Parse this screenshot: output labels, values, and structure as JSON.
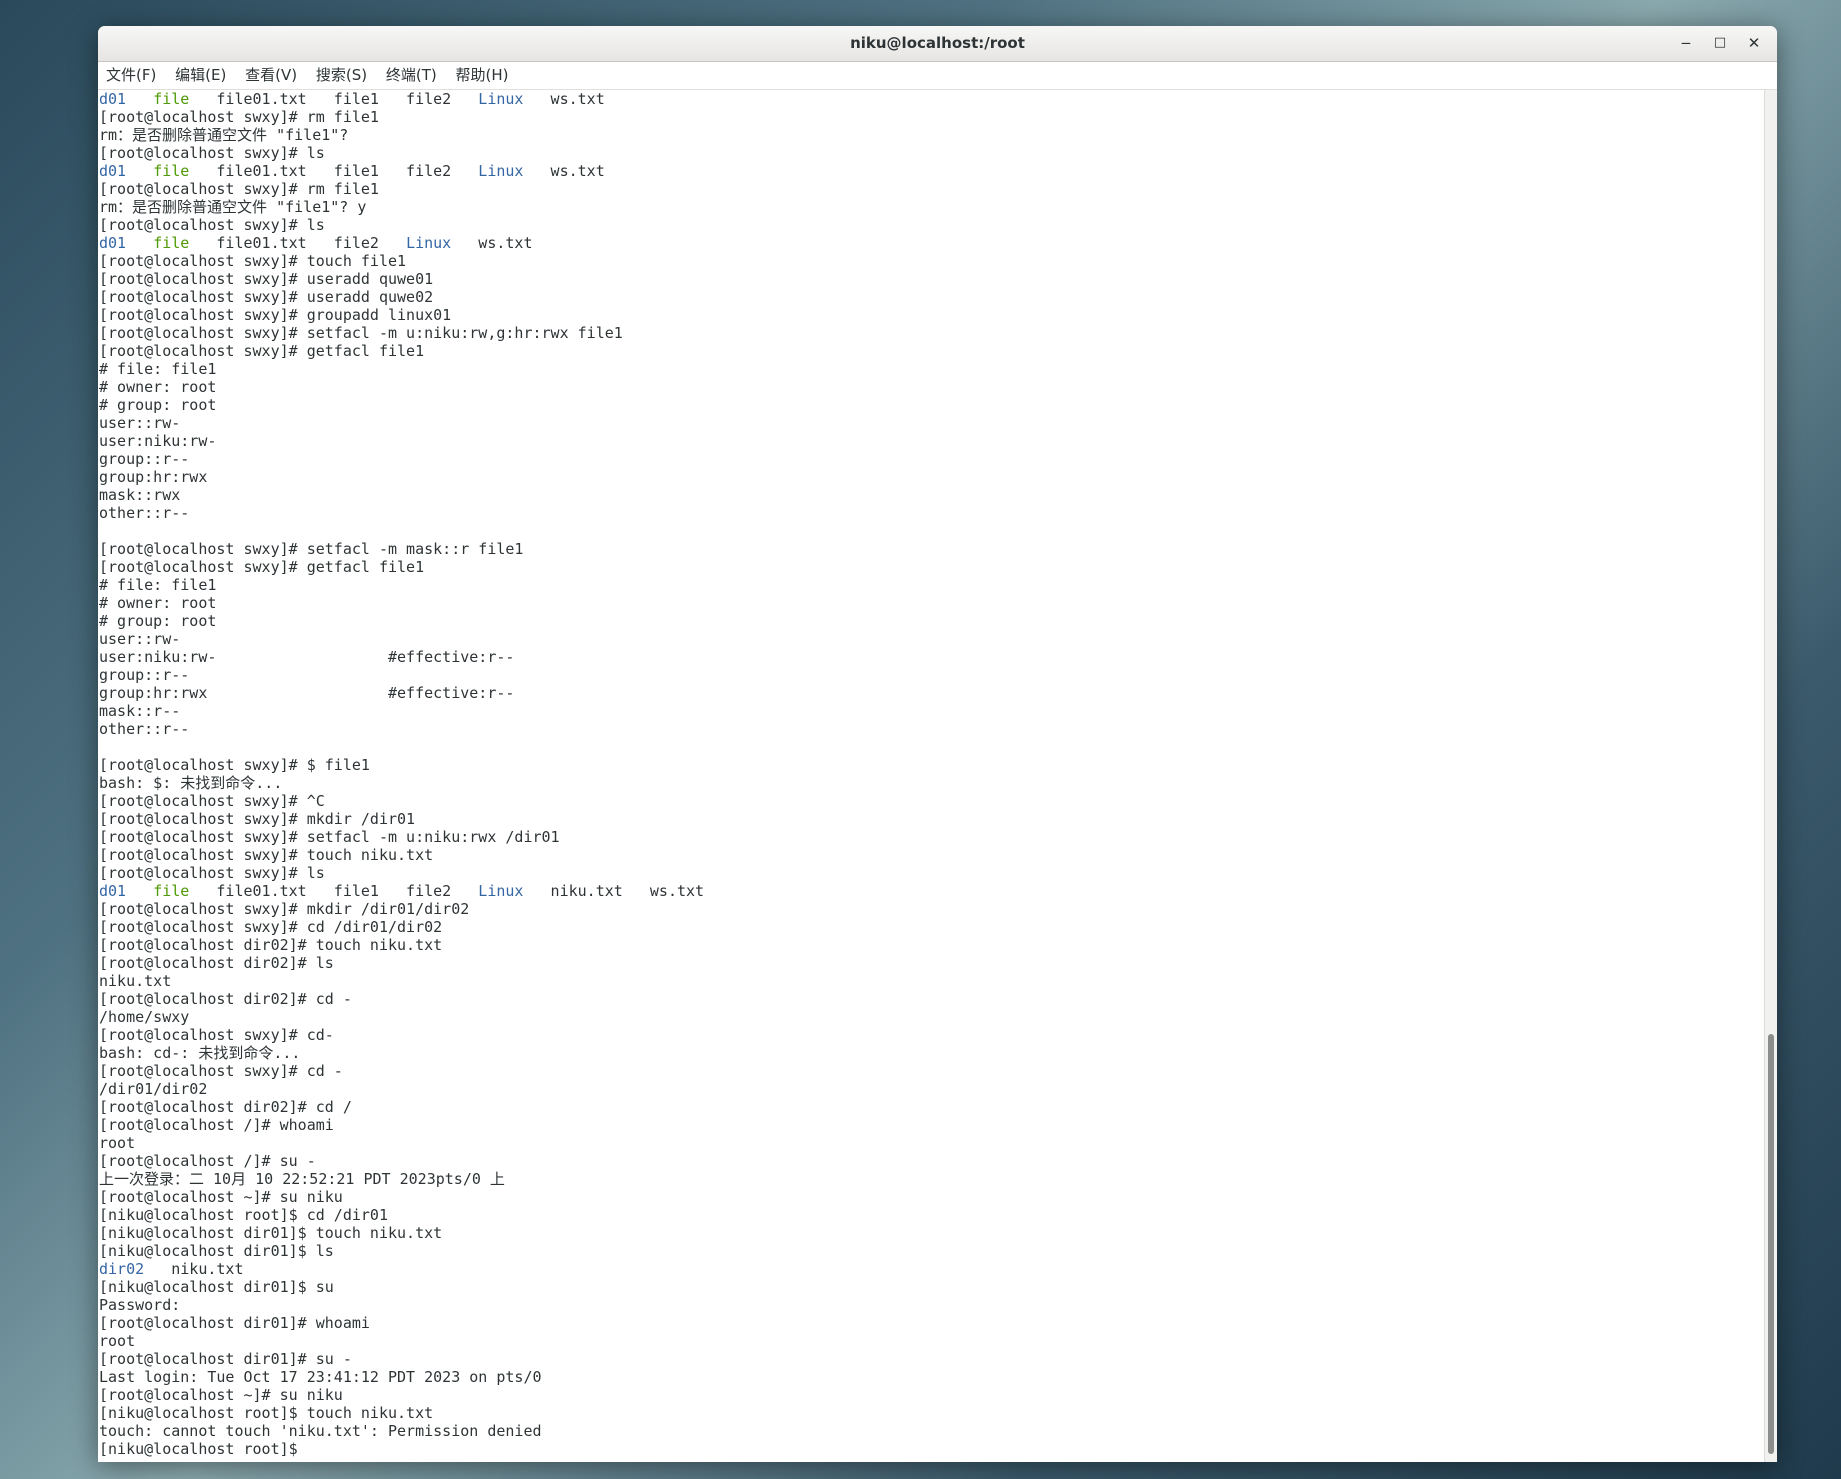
{
  "window": {
    "title": "niku@localhost:/root",
    "controls": {
      "minimize": "‒",
      "maximize": "□",
      "close": "✕"
    }
  },
  "menu": [
    "文件(F)",
    "编辑(E)",
    "查看(V)",
    "搜索(S)",
    "终端(T)",
    "帮助(H)"
  ],
  "colors": {
    "directory": "#3465a4",
    "executable": "#4e9a06",
    "text": "#2e3436"
  },
  "terminal": {
    "lines": [
      [
        {
          "t": "d01",
          "c": "dir"
        },
        {
          "t": "   "
        },
        {
          "t": "file",
          "c": "exe"
        },
        {
          "t": "   file01.txt   file1   file2   "
        },
        {
          "t": "Linux",
          "c": "dir"
        },
        {
          "t": "   ws.txt"
        }
      ],
      "[root@localhost swxy]# rm file1",
      "rm：是否删除普通空文件 \"file1\"?",
      "[root@localhost swxy]# ls",
      [
        {
          "t": "d01",
          "c": "dir"
        },
        {
          "t": "   "
        },
        {
          "t": "file",
          "c": "exe"
        },
        {
          "t": "   file01.txt   file1   file2   "
        },
        {
          "t": "Linux",
          "c": "dir"
        },
        {
          "t": "   ws.txt"
        }
      ],
      "[root@localhost swxy]# rm file1",
      "rm：是否删除普通空文件 \"file1\"? y",
      "[root@localhost swxy]# ls",
      [
        {
          "t": "d01",
          "c": "dir"
        },
        {
          "t": "   "
        },
        {
          "t": "file",
          "c": "exe"
        },
        {
          "t": "   file01.txt   file2   "
        },
        {
          "t": "Linux",
          "c": "dir"
        },
        {
          "t": "   ws.txt"
        }
      ],
      "[root@localhost swxy]# touch file1",
      "[root@localhost swxy]# useradd quwe01",
      "[root@localhost swxy]# useradd quwe02",
      "[root@localhost swxy]# groupadd linux01",
      "[root@localhost swxy]# setfacl -m u:niku:rw,g:hr:rwx file1",
      "[root@localhost swxy]# getfacl file1",
      "# file: file1",
      "# owner: root",
      "# group: root",
      "user::rw-",
      "user:niku:rw-",
      "group::r--",
      "group:hr:rwx",
      "mask::rwx",
      "other::r--",
      "",
      "[root@localhost swxy]# setfacl -m mask::r file1",
      "[root@localhost swxy]# getfacl file1",
      "# file: file1",
      "# owner: root",
      "# group: root",
      "user::rw-",
      "user:niku:rw-                   #effective:r--",
      "group::r--",
      "group:hr:rwx                    #effective:r--",
      "mask::r--",
      "other::r--",
      "",
      "[root@localhost swxy]# $ file1",
      "bash: $: 未找到命令...",
      "[root@localhost swxy]# ^C",
      "[root@localhost swxy]# mkdir /dir01",
      "[root@localhost swxy]# setfacl -m u:niku:rwx /dir01",
      "[root@localhost swxy]# touch niku.txt",
      "[root@localhost swxy]# ls",
      [
        {
          "t": "d01",
          "c": "dir"
        },
        {
          "t": "   "
        },
        {
          "t": "file",
          "c": "exe"
        },
        {
          "t": "   file01.txt   file1   file2   "
        },
        {
          "t": "Linux",
          "c": "dir"
        },
        {
          "t": "   niku.txt   ws.txt"
        }
      ],
      "[root@localhost swxy]# mkdir /dir01/dir02",
      "[root@localhost swxy]# cd /dir01/dir02",
      "[root@localhost dir02]# touch niku.txt",
      "[root@localhost dir02]# ls",
      "niku.txt",
      "[root@localhost dir02]# cd -",
      "/home/swxy",
      "[root@localhost swxy]# cd-",
      "bash: cd-: 未找到命令...",
      "[root@localhost swxy]# cd -",
      "/dir01/dir02",
      "[root@localhost dir02]# cd /",
      "[root@localhost /]# whoami",
      "root",
      "[root@localhost /]# su -",
      "上一次登录：二 10月 10 22:52:21 PDT 2023pts/0 上",
      "[root@localhost ~]# su niku",
      "[niku@localhost root]$ cd /dir01",
      "[niku@localhost dir01]$ touch niku.txt",
      "[niku@localhost dir01]$ ls",
      [
        {
          "t": "dir02",
          "c": "dir"
        },
        {
          "t": "   niku.txt"
        }
      ],
      "[niku@localhost dir01]$ su",
      "Password:",
      "[root@localhost dir01]# whoami",
      "root",
      "[root@localhost dir01]# su -",
      "Last login: Tue Oct 17 23:41:12 PDT 2023 on pts/0",
      "[root@localhost ~]# su niku",
      "[niku@localhost root]$ touch niku.txt",
      "touch: cannot touch 'niku.txt': Permission denied",
      "[niku@localhost root]$ "
    ]
  }
}
